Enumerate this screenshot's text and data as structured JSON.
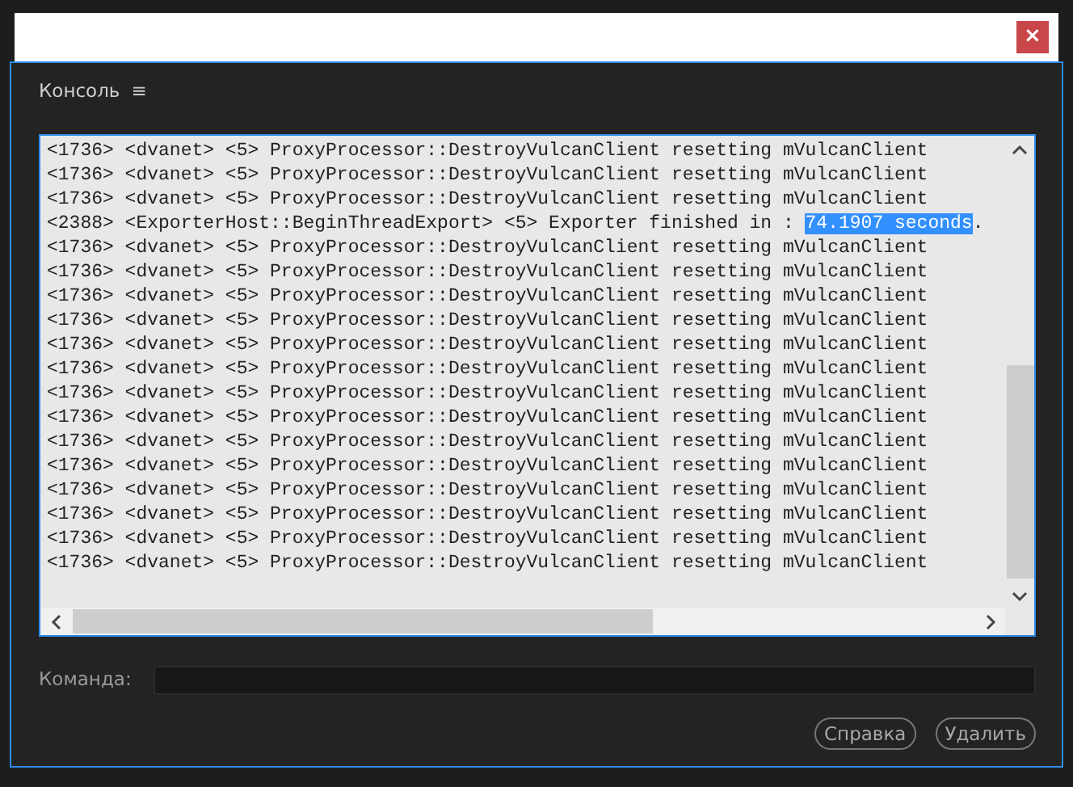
{
  "dialog": {
    "close_label": "×"
  },
  "panel": {
    "title": "Консоль",
    "menu_glyph": "≡"
  },
  "log": {
    "lines": [
      [
        {
          "text": "<1736> <dvanet> <5> ProxyProcessor::DestroyVulcanClient resetting mVulcanClient",
          "selected": false
        }
      ],
      [
        {
          "text": "<1736> <dvanet> <5> ProxyProcessor::DestroyVulcanClient resetting mVulcanClient",
          "selected": false
        }
      ],
      [
        {
          "text": "<1736> <dvanet> <5> ProxyProcessor::DestroyVulcanClient resetting mVulcanClient",
          "selected": false
        }
      ],
      [
        {
          "text": "<2388> <ExporterHost::BeginThreadExport> <5> Exporter finished in : ",
          "selected": false
        },
        {
          "text": "74.1907 seconds",
          "selected": true
        },
        {
          "text": ".",
          "selected": false
        }
      ],
      [
        {
          "text": "<1736> <dvanet> <5> ProxyProcessor::DestroyVulcanClient resetting mVulcanClient",
          "selected": false
        }
      ],
      [
        {
          "text": "<1736> <dvanet> <5> ProxyProcessor::DestroyVulcanClient resetting mVulcanClient",
          "selected": false
        }
      ],
      [
        {
          "text": "<1736> <dvanet> <5> ProxyProcessor::DestroyVulcanClient resetting mVulcanClient",
          "selected": false
        }
      ],
      [
        {
          "text": "<1736> <dvanet> <5> ProxyProcessor::DestroyVulcanClient resetting mVulcanClient",
          "selected": false
        }
      ],
      [
        {
          "text": "<1736> <dvanet> <5> ProxyProcessor::DestroyVulcanClient resetting mVulcanClient",
          "selected": false
        }
      ],
      [
        {
          "text": "<1736> <dvanet> <5> ProxyProcessor::DestroyVulcanClient resetting mVulcanClient",
          "selected": false
        }
      ],
      [
        {
          "text": "<1736> <dvanet> <5> ProxyProcessor::DestroyVulcanClient resetting mVulcanClient",
          "selected": false
        }
      ],
      [
        {
          "text": "<1736> <dvanet> <5> ProxyProcessor::DestroyVulcanClient resetting mVulcanClient",
          "selected": false
        }
      ],
      [
        {
          "text": "<1736> <dvanet> <5> ProxyProcessor::DestroyVulcanClient resetting mVulcanClient",
          "selected": false
        }
      ],
      [
        {
          "text": "<1736> <dvanet> <5> ProxyProcessor::DestroyVulcanClient resetting mVulcanClient",
          "selected": false
        }
      ],
      [
        {
          "text": "<1736> <dvanet> <5> ProxyProcessor::DestroyVulcanClient resetting mVulcanClient",
          "selected": false
        }
      ],
      [
        {
          "text": "<1736> <dvanet> <5> ProxyProcessor::DestroyVulcanClient resetting mVulcanClient",
          "selected": false
        }
      ],
      [
        {
          "text": "<1736> <dvanet> <5> ProxyProcessor::DestroyVulcanClient resetting mVulcanClient",
          "selected": false
        }
      ],
      [
        {
          "text": "<1736> <dvanet> <5> ProxyProcessor::DestroyVulcanClient resetting mVulcanClient",
          "selected": false
        }
      ]
    ]
  },
  "command": {
    "label": "Команда:"
  },
  "buttons": [
    "Справка",
    "Удалить"
  ]
}
